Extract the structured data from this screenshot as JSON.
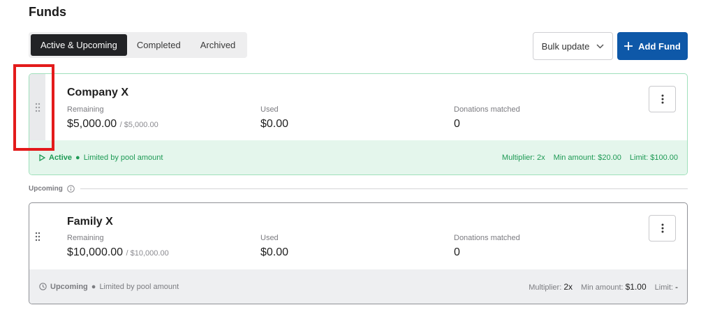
{
  "page": {
    "title": "Funds"
  },
  "tabs": [
    {
      "label": "Active & Upcoming",
      "active": true
    },
    {
      "label": "Completed",
      "active": false
    },
    {
      "label": "Archived",
      "active": false
    }
  ],
  "toolbar": {
    "bulk_update_label": "Bulk update",
    "add_fund_label": "Add Fund"
  },
  "colors": {
    "accent": "#0e58a8",
    "active_green": "#1e9a55",
    "annotation_red": "#e31b1b"
  },
  "funds": [
    {
      "name": "Company X",
      "remaining_label": "Remaining",
      "remaining": "$5,000.00",
      "total": "/ $5,000.00",
      "used_label": "Used",
      "used": "$0.00",
      "matched_label": "Donations matched",
      "matched": "0",
      "status": "Active",
      "status_note": "Limited by pool amount",
      "multiplier": "Multiplier: 2x",
      "min_amount": "Min amount: $20.00",
      "limit": "Limit: $100.00"
    },
    {
      "name": "Family X",
      "remaining_label": "Remaining",
      "remaining": "$10,000.00",
      "total": "/ $10,000.00",
      "used_label": "Used",
      "used": "$0.00",
      "matched_label": "Donations matched",
      "matched": "0",
      "status": "Upcoming",
      "status_note": "Limited by pool amount",
      "multiplier_label": "Multiplier:",
      "multiplier_value": "2x",
      "min_amount_label": "Min amount:",
      "min_amount_value": "$1.00",
      "limit_label": "Limit:",
      "limit_value": "-"
    }
  ],
  "sections": {
    "upcoming_label": "Upcoming"
  },
  "icons": {
    "drag": "drag-handle-icon",
    "more": "more-vertical-icon",
    "play": "play-icon",
    "clock": "clock-icon",
    "info": "info-icon",
    "plus": "plus-icon",
    "chevron": "chevron-down-icon"
  }
}
